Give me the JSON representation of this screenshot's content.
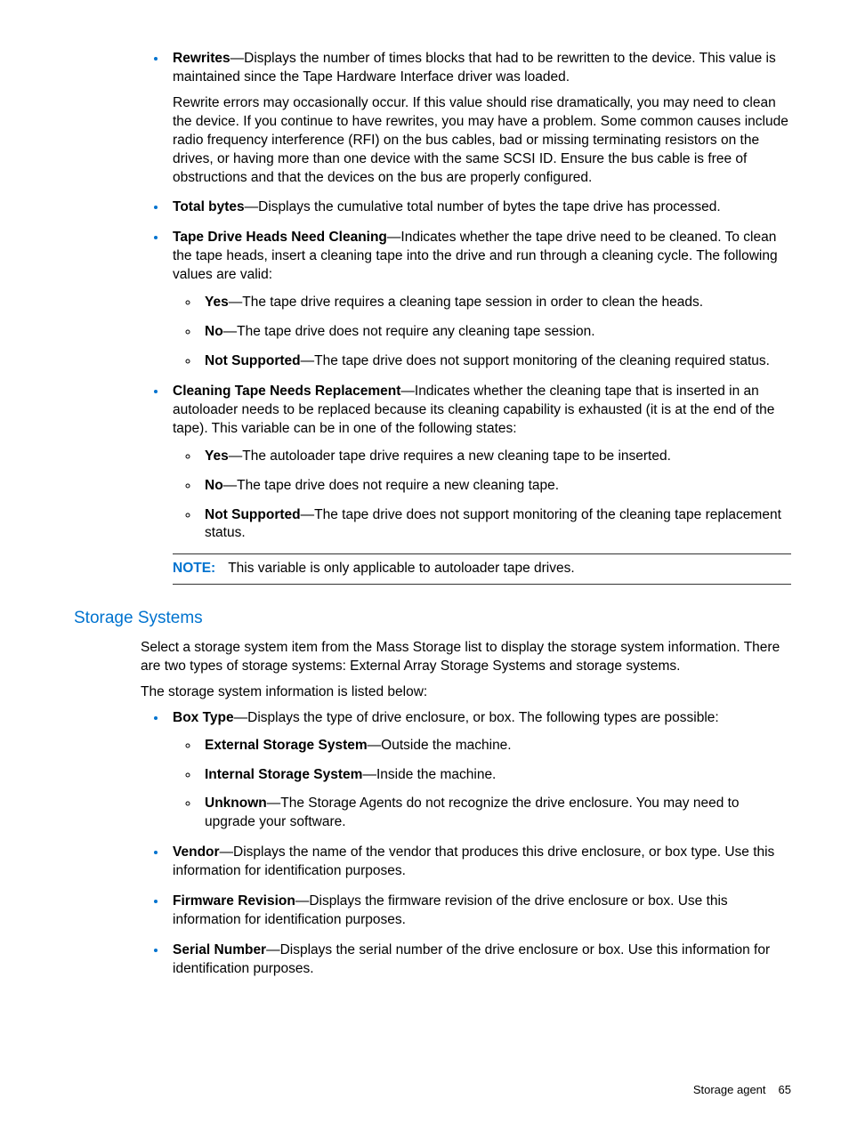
{
  "s1": {
    "items": [
      {
        "term": "Rewrites",
        "desc": "—Displays the number of times blocks that had to be rewritten to the device. This value is maintained since the Tape Hardware Interface driver was loaded.",
        "extra": "Rewrite errors may occasionally occur. If this value should rise dramatically, you may need to clean the device. If you continue to have rewrites, you may have a problem. Some common causes include radio frequency interference (RFI) on the bus cables, bad or missing terminating resistors on the drives, or having more than one device with the same SCSI ID. Ensure the bus cable is free of obstructions and that the devices on the bus are properly configured."
      },
      {
        "term": "Total bytes",
        "desc": "—Displays the cumulative total number of bytes the tape drive has processed."
      },
      {
        "term": "Tape Drive Heads Need Cleaning",
        "desc": "—Indicates whether the tape drive need to be cleaned. To clean the tape heads, insert a cleaning tape into the drive and run through a cleaning cycle. The following values are valid:",
        "sub": [
          {
            "term": "Yes",
            "desc": "—The tape drive requires a cleaning tape session in order to clean the heads."
          },
          {
            "term": "No",
            "desc": "—The tape drive does not require any cleaning tape session."
          },
          {
            "term": "Not Supported",
            "desc": "—The tape drive does not support monitoring of the cleaning required status."
          }
        ]
      },
      {
        "term": "Cleaning Tape Needs Replacement",
        "desc": "—Indicates whether the cleaning tape that is inserted in an autoloader needs to be replaced because its cleaning capability is exhausted (it is at the end of the tape). This variable can be in one of the following states:",
        "sub": [
          {
            "term": "Yes",
            "desc": "—The autoloader tape drive requires a new cleaning tape to be inserted."
          },
          {
            "term": "No",
            "desc": "—The tape drive does not require a new cleaning tape."
          },
          {
            "term": "Not Supported",
            "desc": "—The tape drive does not support monitoring of the cleaning tape replacement status."
          }
        ]
      }
    ]
  },
  "note": {
    "label": "NOTE:",
    "text": "This variable is only applicable to autoloader tape drives."
  },
  "s2": {
    "heading": "Storage Systems",
    "p1": "Select a storage system item from the Mass Storage list to display the storage system information. There are two types of storage systems: External Array Storage Systems and storage systems.",
    "p2": "The storage system information is listed below:",
    "items": [
      {
        "term": "Box Type",
        "desc": "—Displays the type of drive enclosure, or box. The following types are possible:",
        "sub": [
          {
            "term": "External Storage System",
            "desc": "—Outside the machine."
          },
          {
            "term": "Internal Storage System",
            "desc": "—Inside the machine."
          },
          {
            "term": "Unknown",
            "desc": "—The Storage Agents do not recognize the drive enclosure. You may need to upgrade your software."
          }
        ]
      },
      {
        "term": "Vendor",
        "desc": "—Displays the name of the vendor that produces this drive enclosure, or box type. Use this information for identification purposes."
      },
      {
        "term": "Firmware Revision",
        "desc": "—Displays the firmware revision of the drive enclosure or box. Use this information for identification purposes."
      },
      {
        "term": "Serial Number",
        "desc": "—Displays the serial number of the drive enclosure or box. Use this information for identification purposes."
      }
    ]
  },
  "footer": {
    "title": "Storage agent",
    "page": "65"
  }
}
